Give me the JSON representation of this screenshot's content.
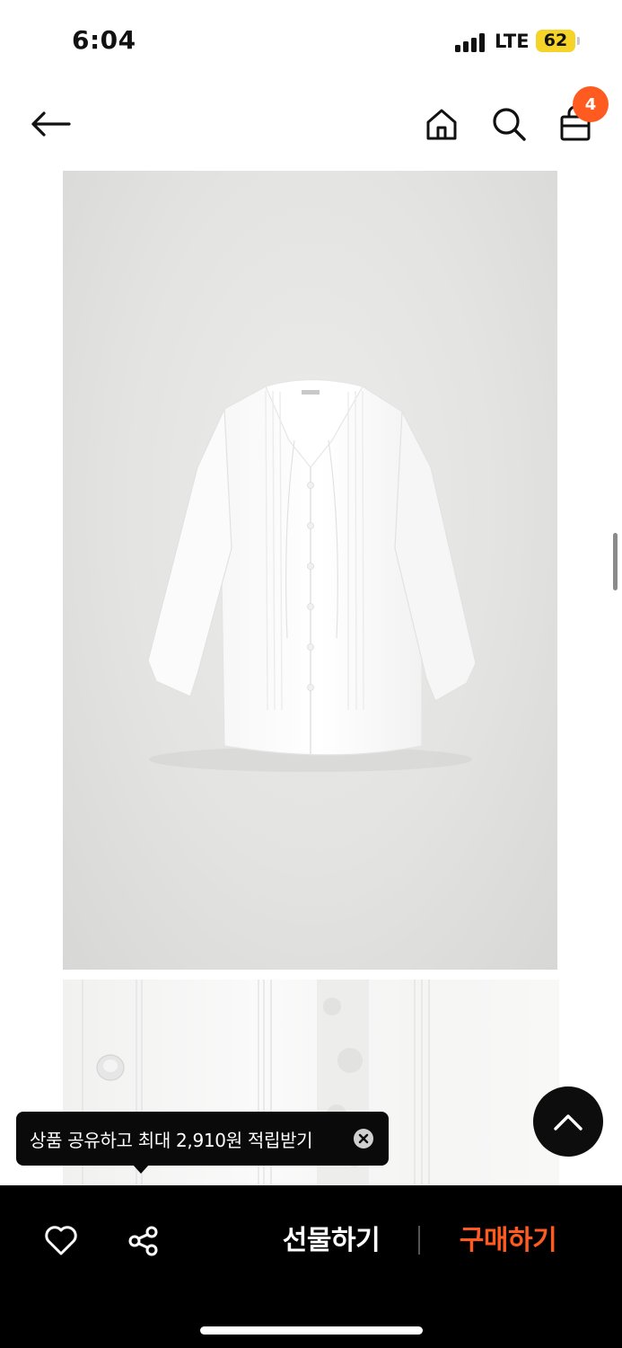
{
  "status_bar": {
    "time": "6:04",
    "network": "LTE",
    "battery": "62",
    "battery_color": "#f5d328"
  },
  "nav": {
    "back_icon": "back-arrow-icon",
    "home_icon": "home-icon",
    "search_icon": "search-icon",
    "cart_icon": "shopping-bag-icon",
    "cart_count": "4",
    "badge_color": "#ff5a1f"
  },
  "product": {
    "main_image_label": "white pintuck blouse with tie neck",
    "tag_text": ""
  },
  "tooltip": {
    "text": "상품 공유하고 최대 2,910원 적립받기",
    "close_icon": "close-circle-icon"
  },
  "bottom_bar": {
    "wishlist_icon": "heart-icon",
    "share_icon": "share-icon",
    "gift_label": "선물하기",
    "buy_label": "구매하기",
    "buy_color": "#ff5a1f"
  },
  "scroll_top_icon": "chevron-up-icon"
}
